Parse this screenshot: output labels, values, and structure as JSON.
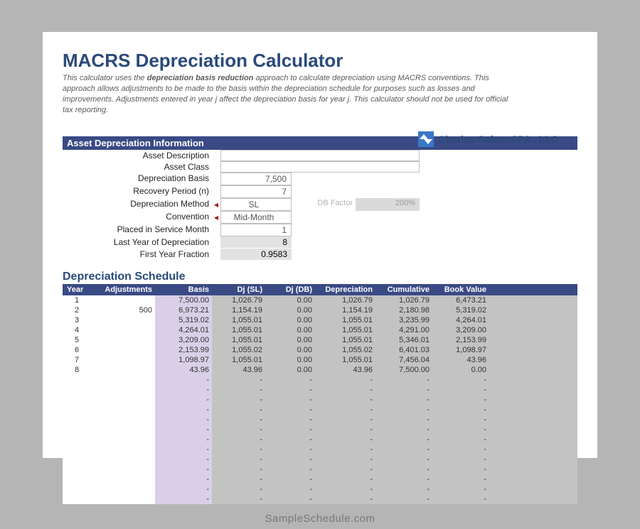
{
  "title": "MACRS Depreciation Calculator",
  "description": {
    "pre": "This calculator uses the ",
    "bold": "depreciation basis reduction",
    "post": " approach to calculate depreciation using MACRS conventions. This approach allows adjustments to be made to the basis within the depreciation schedule for purposes such as losses and improvements. Adjustments entered in year j affect the depreciation basis for year j. This calculator should not be used for official tax reporting."
  },
  "branding": "Charles Coker, CPA , LLC",
  "info_section_title": "Asset Depreciation Information",
  "info": {
    "asset_description": {
      "label": "Asset Description",
      "value": ""
    },
    "asset_class": {
      "label": "Asset Class",
      "value": ""
    },
    "depreciation_basis": {
      "label": "Depreciation Basis",
      "value": "7,500"
    },
    "recovery_period": {
      "label": "Recovery Period (n)",
      "value": "7"
    },
    "depreciation_method": {
      "label": "Depreciation Method",
      "value": "SL"
    },
    "db_factor": {
      "label": "DB Factor",
      "value": "200%"
    },
    "convention": {
      "label": "Convention",
      "value": "Mid-Month"
    },
    "placed_in_service": {
      "label": "Placed in Service Month",
      "value": "1"
    },
    "last_year": {
      "label": "Last Year of Depreciation",
      "value": "8"
    },
    "first_year_fraction": {
      "label": "First Year Fraction",
      "value": "0.9583"
    }
  },
  "schedule_title": "Depreciation Schedule",
  "schedule_headers": {
    "year": "Year",
    "adjustments": "Adjustments",
    "basis": "Basis",
    "dj_sl": "Dj (SL)",
    "dj_db": "Dj (DB)",
    "depreciation": "Depreciation",
    "cumulative": "Cumulative",
    "book_value": "Book Value"
  },
  "schedule": [
    {
      "year": "1",
      "adj": "",
      "basis": "7,500.00",
      "sl": "1,026.79",
      "db": "0.00",
      "dep": "1,026.79",
      "cum": "1,026.79",
      "bv": "6,473.21"
    },
    {
      "year": "2",
      "adj": "500",
      "basis": "6,973.21",
      "sl": "1,154.19",
      "db": "0.00",
      "dep": "1,154.19",
      "cum": "2,180.98",
      "bv": "5,319.02"
    },
    {
      "year": "3",
      "adj": "",
      "basis": "5,319.02",
      "sl": "1,055.01",
      "db": "0.00",
      "dep": "1,055.01",
      "cum": "3,235.99",
      "bv": "4,264.01"
    },
    {
      "year": "4",
      "adj": "",
      "basis": "4,264.01",
      "sl": "1,055.01",
      "db": "0.00",
      "dep": "1,055.01",
      "cum": "4,291.00",
      "bv": "3,209.00"
    },
    {
      "year": "5",
      "adj": "",
      "basis": "3,209.00",
      "sl": "1,055.01",
      "db": "0.00",
      "dep": "1,055.01",
      "cum": "5,346.01",
      "bv": "2,153.99"
    },
    {
      "year": "6",
      "adj": "",
      "basis": "2,153.99",
      "sl": "1,055.02",
      "db": "0.00",
      "dep": "1,055.02",
      "cum": "6,401.03",
      "bv": "1,098.97"
    },
    {
      "year": "7",
      "adj": "",
      "basis": "1,098.97",
      "sl": "1,055.01",
      "db": "0.00",
      "dep": "1,055.01",
      "cum": "7,456.04",
      "bv": "43.96"
    },
    {
      "year": "8",
      "adj": "",
      "basis": "43.96",
      "sl": "43.96",
      "db": "0.00",
      "dep": "43.96",
      "cum": "7,500.00",
      "bv": "0.00"
    }
  ],
  "empty_rows": 13,
  "watermark": "SampleSchedule.com"
}
